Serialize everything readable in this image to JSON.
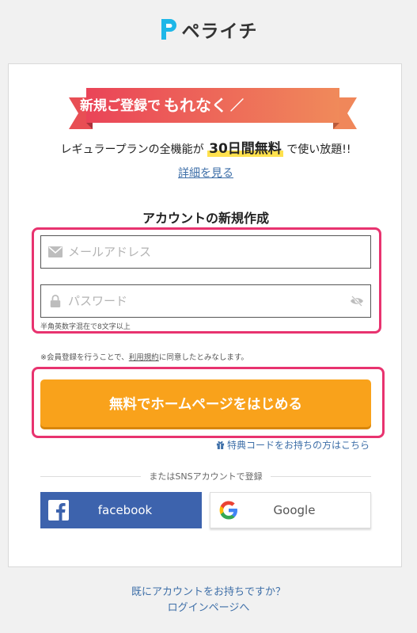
{
  "header": {
    "logo_text": "ペライチ"
  },
  "promo": {
    "ribbon_lead": "＼ 新規ご登録で",
    "ribbon_emph": "もれなく",
    "ribbon_tail": "／",
    "plan_prefix": "レギュラープランの全機能が",
    "plan_highlight": "30日間無料",
    "plan_suffix": "で使い放題!!",
    "detail_link": "詳細を見る",
    "ribbon_color": "#f05a5f"
  },
  "form": {
    "title": "アカウントの新規作成",
    "email": {
      "placeholder": "メールアドレス",
      "value": ""
    },
    "password": {
      "placeholder": "パスワード",
      "value": ""
    },
    "password_hint": "半角英数字混在で8文字以上",
    "terms_prefix": "※会員登録を行うことで、",
    "terms_link": "利用規約",
    "terms_suffix": "に同意したとみなします。",
    "submit_label": "無料でホームページをはじめる",
    "coupon_link": "特典コードをお持ちの方はこちら",
    "accent_color": "#f9a21b",
    "highlight_color": "#e8336f"
  },
  "sns": {
    "divider_label": "またはSNSアカウントで登録",
    "facebook_label": "facebook",
    "google_label": "Google",
    "facebook_color": "#3d63ad"
  },
  "footer": {
    "have_account": "既にアカウントをお持ちですか？",
    "login_link": "ログインページへ"
  }
}
